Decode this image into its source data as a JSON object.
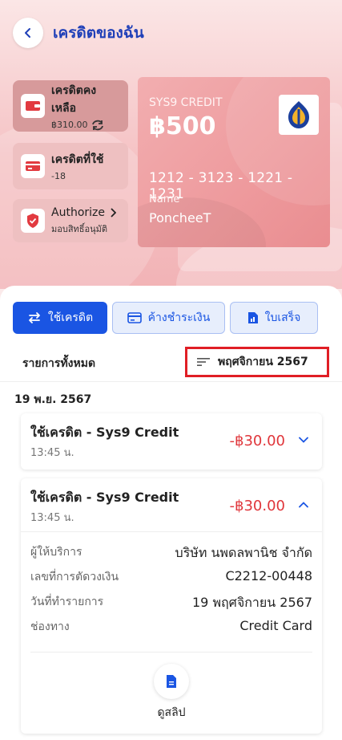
{
  "header": {
    "title": "เครดิตของฉัน"
  },
  "chips": {
    "balance": {
      "label": "เครดิตคงเหลือ",
      "value": "฿310.00"
    },
    "used": {
      "label": "เครดิตที่ใช้",
      "value": "-18"
    },
    "authorize": {
      "label": "Authorize",
      "sub": "มอบสิทธิ์อนุมัติ"
    }
  },
  "card": {
    "name": "SYS9 CREDIT",
    "amount": "฿500",
    "number": "1212 - 3123 - 1221 - 1231",
    "name_label": "Name",
    "holder": "PoncheeT"
  },
  "tabs": [
    {
      "label": "ใช้เครดิต",
      "active": true
    },
    {
      "label": "ค้างชำระเงิน",
      "active": false
    },
    {
      "label": "ใบเสร็จ",
      "active": false
    }
  ],
  "filter": {
    "all_label": "รายการทั้งหมด",
    "month": "พฤศจิกายน 2567"
  },
  "date_heading": "19 พ.ย. 2567",
  "transactions": [
    {
      "title": "ใช้เครดิต - Sys9 Credit",
      "time": "13:45 น.",
      "amount": "-฿30.00",
      "expanded": false
    },
    {
      "title": "ใช้เครดิต - Sys9 Credit",
      "time": "13:45 น.",
      "amount": "-฿30.00",
      "expanded": true,
      "details": [
        {
          "key": "ผู้ให้บริการ",
          "value": "บริษัท นพดลพานิช จำกัด"
        },
        {
          "key": "เลขที่การตัดวงเงิน",
          "value": "C2212-00448"
        },
        {
          "key": "วันที่ทำรายการ",
          "value": "19 พฤศจิกายน 2567"
        },
        {
          "key": "ช่องทาง",
          "value": "Credit Card"
        }
      ],
      "slip_label": "ดูสลิป"
    }
  ],
  "colors": {
    "accent": "#1a55e3",
    "amount_red": "#e0363b",
    "filter_border": "#e01e25"
  }
}
